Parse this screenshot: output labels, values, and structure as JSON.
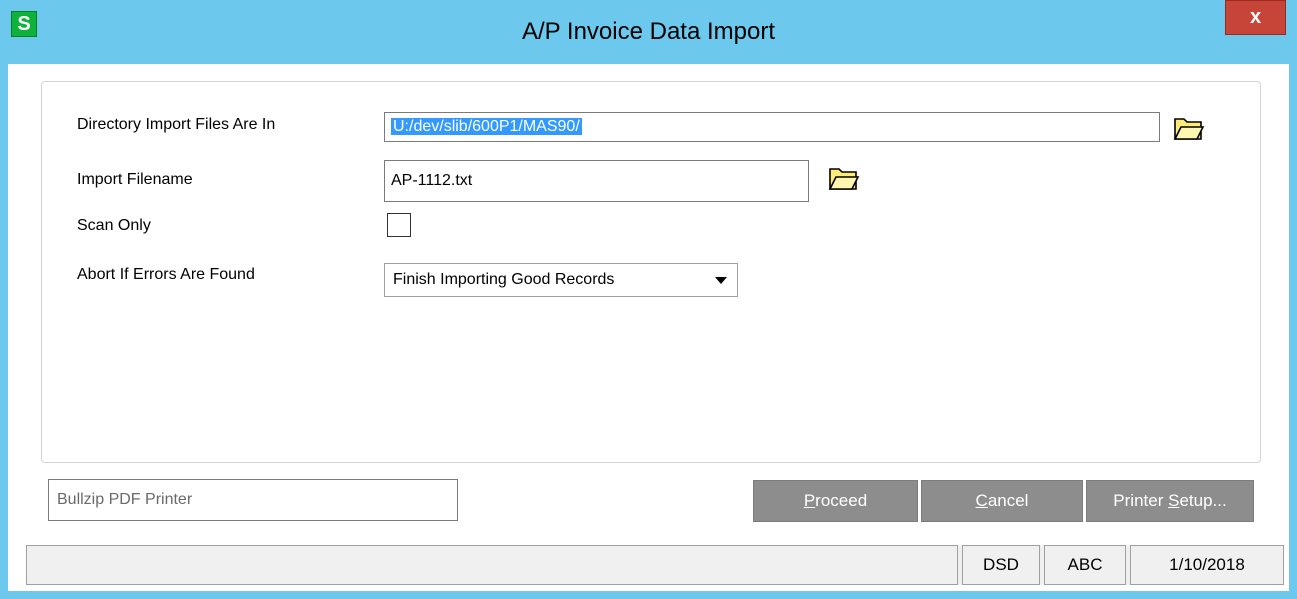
{
  "window": {
    "title": "A/P Invoice Data Import",
    "app_icon_letter": "S",
    "close_label": "x"
  },
  "form": {
    "directory_label": "Directory Import Files Are In",
    "directory_value": "U:/dev/slib/600P1/MAS90/",
    "filename_label": "Import Filename",
    "filename_value": "AP-1112.txt",
    "scan_only_label": "Scan Only",
    "scan_only_checked": false,
    "abort_label": "Abort If Errors Are Found",
    "abort_value": "Finish Importing Good Records"
  },
  "printer": {
    "name": "Bullzip PDF Printer"
  },
  "buttons": {
    "proceed_pre": "",
    "proceed_u": "P",
    "proceed_post": "roceed",
    "cancel_pre": "",
    "cancel_u": "C",
    "cancel_post": "ancel",
    "setup_pre": "Printer ",
    "setup_u": "S",
    "setup_post": "etup..."
  },
  "statusbar": {
    "message": "",
    "module": "DSD",
    "company": "ABC",
    "date": "1/10/2018"
  },
  "colors": {
    "titlebar": "#6cc8ec",
    "close": "#c64538",
    "selection": "#3399ff",
    "button": "#8d8d8d",
    "app_icon": "#0fb23a"
  }
}
